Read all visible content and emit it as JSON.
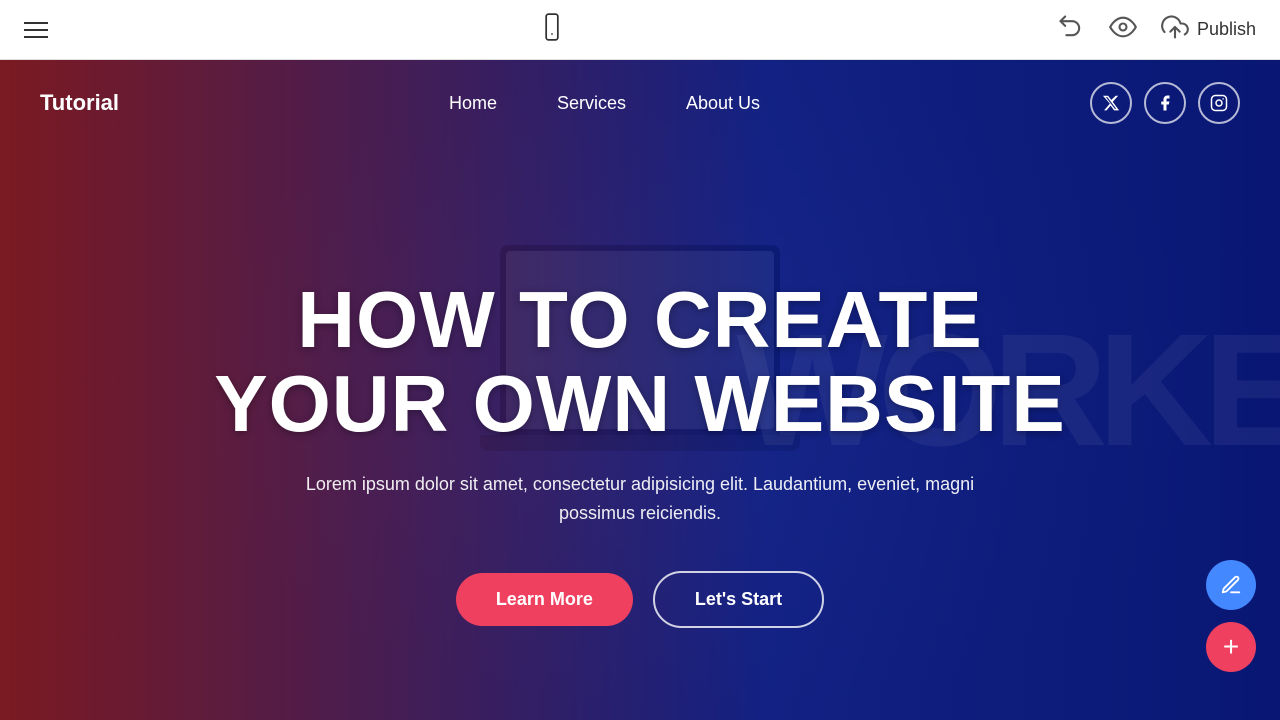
{
  "topbar": {
    "hamburger_label": "menu",
    "undo_label": "undo",
    "preview_label": "preview",
    "publish_icon_label": "publish-cloud",
    "publish_label": "Publish"
  },
  "site": {
    "logo": "Tutorial",
    "nav": {
      "home": "Home",
      "services": "Services",
      "about_us": "About Us"
    },
    "social": {
      "twitter": "𝕏",
      "facebook": "f",
      "instagram": "📷"
    }
  },
  "hero": {
    "title_line1": "HOW TO CREATE",
    "title_line2": "YOUR OWN WEBSITE",
    "subtitle": "Lorem ipsum dolor sit amet, consectetur adipisicing elit. Laudantium, eveniet, magni possimus reiciendis.",
    "btn_learn_more": "Learn More",
    "btn_lets_start": "Let's Start"
  },
  "fab": {
    "pen": "✏",
    "plus": "+"
  }
}
